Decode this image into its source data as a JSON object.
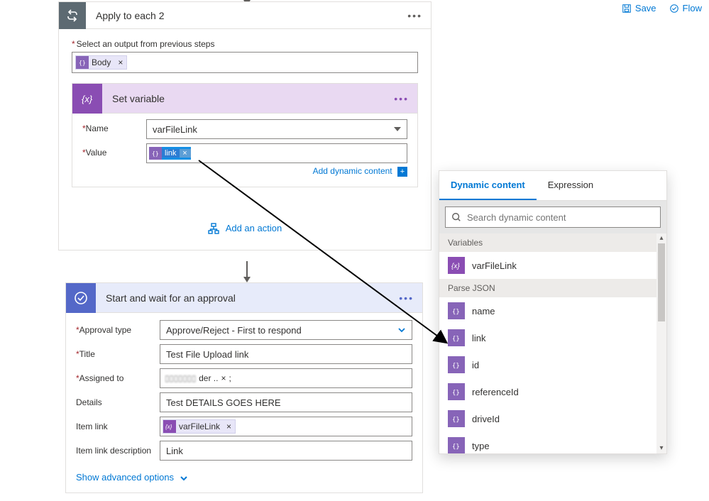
{
  "toolbar": {
    "save": "Save",
    "flow": "Flow"
  },
  "apply_each": {
    "title": "Apply to each 2",
    "output_label": "Select an output from previous steps",
    "body_chip": "Body",
    "add_action": "Add an action"
  },
  "set_var": {
    "title": "Set variable",
    "name_label": "Name",
    "value_label": "Value",
    "name_value": "varFileLink",
    "link_chip": "link",
    "dynamic_link": "Add dynamic content"
  },
  "approval": {
    "title": "Start and wait for an approval",
    "approval_type_label": "Approval type",
    "approval_type_value": "Approve/Reject - First to respond",
    "title_label": "Title",
    "title_value": "Test File Upload link",
    "assigned_label": "Assigned to",
    "assigned_value_visible": "der ..",
    "details_label": "Details",
    "details_value": "Test DETAILS GOES HERE",
    "item_link_label": "Item link",
    "item_link_chip": "varFileLink",
    "item_link_desc_label": "Item link description",
    "item_link_desc_value": "Link",
    "show_advanced": "Show advanced options"
  },
  "dynamic": {
    "tab_dc": "Dynamic content",
    "tab_expr": "Expression",
    "search_placeholder": "Search dynamic content",
    "sections": {
      "variables": "Variables",
      "parse_json": "Parse JSON"
    },
    "var_item": "varFileLink",
    "parse_items": [
      "name",
      "link",
      "id",
      "referenceId",
      "driveId",
      "type"
    ]
  }
}
